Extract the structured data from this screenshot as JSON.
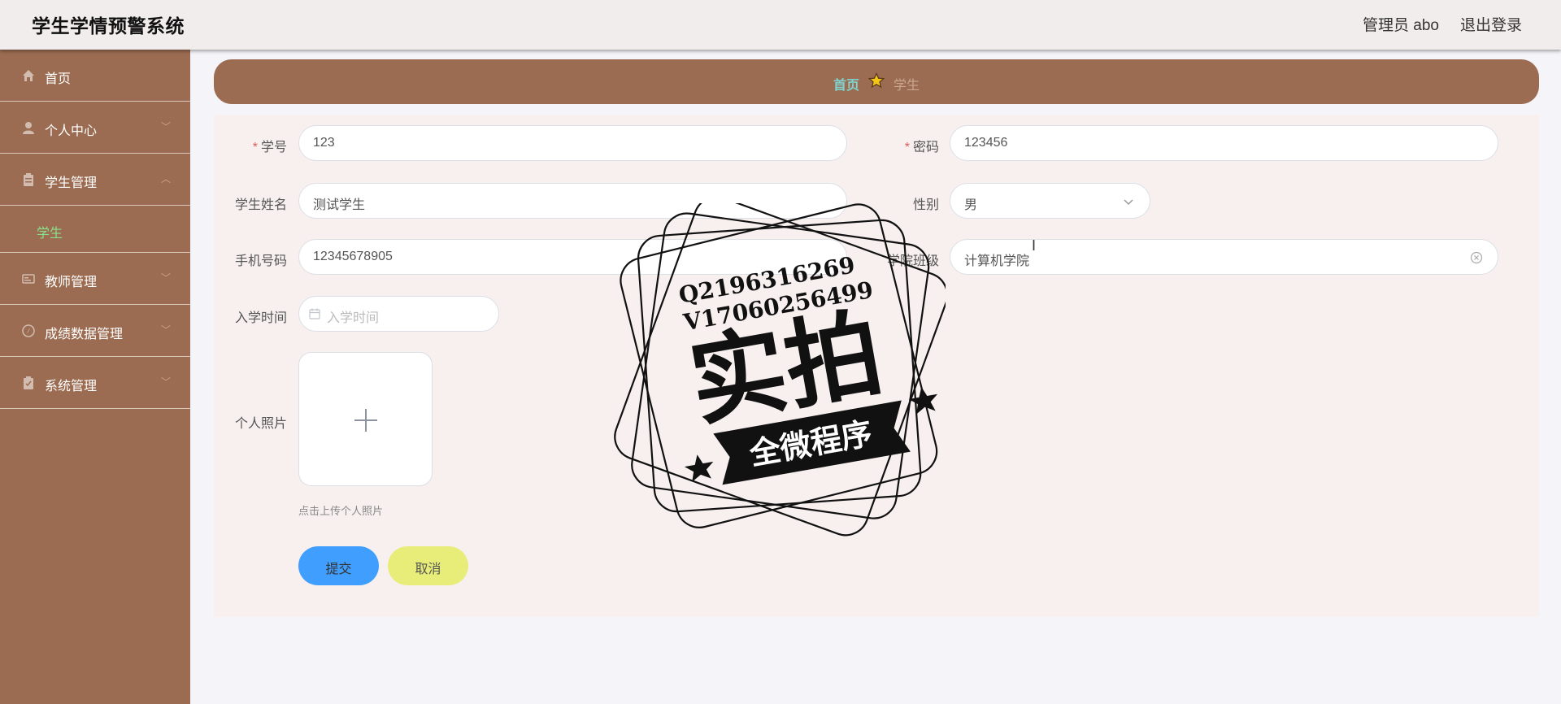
{
  "header": {
    "title": "学生学情预警系统",
    "user": "管理员 abo",
    "logout": "退出登录"
  },
  "sidebar": {
    "items": [
      {
        "label": "首页",
        "icon": "home-icon"
      },
      {
        "label": "个人中心",
        "icon": "user-icon"
      },
      {
        "label": "学生管理",
        "icon": "clipboard-icon",
        "expanded": true,
        "children": [
          {
            "label": "学生",
            "active": true
          }
        ]
      },
      {
        "label": "教师管理",
        "icon": "id-card-icon"
      },
      {
        "label": "成绩数据管理",
        "icon": "compass-icon"
      },
      {
        "label": "系统管理",
        "icon": "clipboard-check-icon"
      }
    ]
  },
  "breadcrumb": {
    "home": "首页",
    "current": "学生"
  },
  "form": {
    "student_no": {
      "label": "学号",
      "value": "123",
      "required": true
    },
    "password": {
      "label": "密码",
      "value": "123456",
      "required": true
    },
    "name": {
      "label": "学生姓名",
      "value": "测试学生"
    },
    "gender": {
      "label": "性别",
      "value": "男"
    },
    "phone": {
      "label": "手机号码",
      "value": "12345678905"
    },
    "college_class": {
      "label": "学院班级",
      "value": "计算机学院"
    },
    "enroll_date": {
      "label": "入学时间",
      "placeholder": "入学时间"
    },
    "photo": {
      "label": "个人照片",
      "hint": "点击上传个人照片"
    },
    "submit": "提交",
    "cancel": "取消"
  },
  "watermark": {
    "line1": "Q2196316269",
    "line2": "V17060256499",
    "main": "实拍",
    "banner": "全微程序"
  },
  "colors": {
    "sidebar": "#9b6c51",
    "active": "#8be08b",
    "primary": "#409eff",
    "cancel": "#e7ed78",
    "breadcrumb_home": "#7fd4d0"
  }
}
